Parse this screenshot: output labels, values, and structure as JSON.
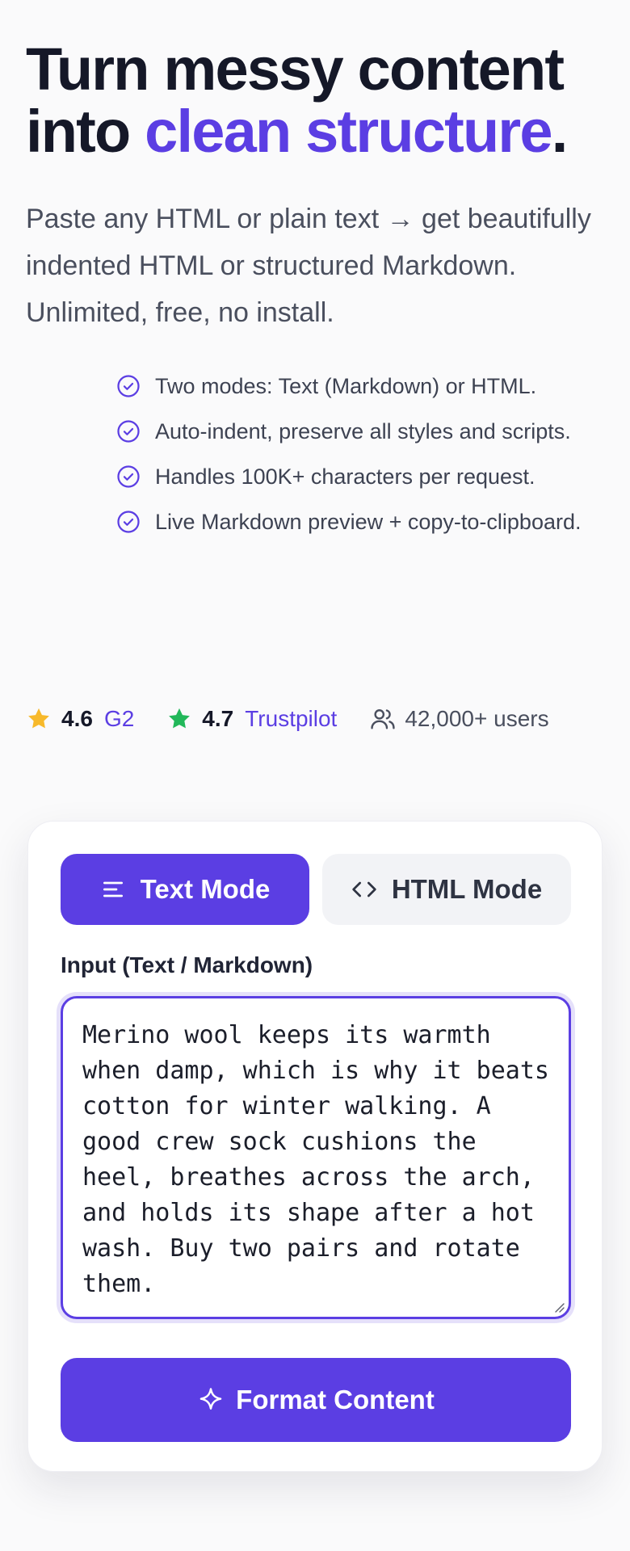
{
  "hero": {
    "headline_line1": "Turn messy content",
    "headline_into": "into ",
    "headline_accent": "clean structure",
    "headline_end": ".",
    "subhead": "Paste any HTML or plain text → get beautifully indented HTML or structured Markdown. Unlimited, free, no install."
  },
  "features": [
    "Two modes: Text (Markdown) or HTML.",
    "Auto-indent, preserve all styles and scripts.",
    "Handles 100K+ characters per request.",
    "Live Markdown preview + copy-to-clipboard."
  ],
  "ratings": {
    "g2": {
      "score": "4.6",
      "site": "G2",
      "star_color": "#f7b92b"
    },
    "trustpilot": {
      "score": "4.7",
      "site": "Trustpilot",
      "star_color": "#22b85a"
    },
    "users": "42,000+ users"
  },
  "formatter": {
    "tabs": {
      "text_label": "Text Mode",
      "html_label": "HTML Mode",
      "active": "text"
    },
    "input_label": "Input (Text / Markdown)",
    "input_value": "Merino wool keeps its warmth when damp, which is why it beats cotton for winter walking. A good crew sock cushions the heel, breathes across the arch, and holds its shape after a hot wash. Buy two pairs and rotate them.",
    "format_button": "Format Content"
  },
  "colors": {
    "accent": "#5b3ee3",
    "text_dark": "#151828",
    "text_muted": "#4a4f5e"
  },
  "icons": {
    "feature": "check-circle-icon",
    "text_tab": "lines-icon",
    "html_tab": "code-brackets-icon",
    "users": "users-icon",
    "format": "sparkle-icon"
  }
}
